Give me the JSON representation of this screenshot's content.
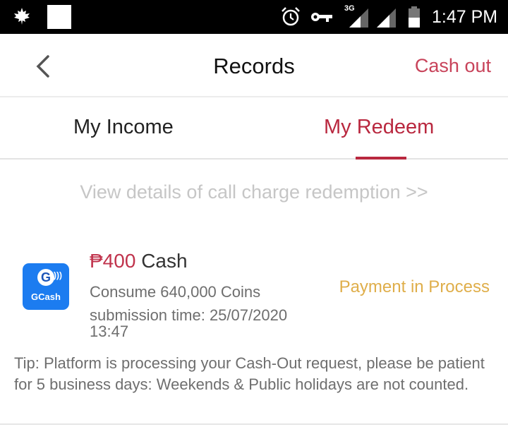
{
  "status_bar": {
    "time": "1:47 PM",
    "network": "3G",
    "icons": [
      "maple-leaf-icon",
      "notification-box-icon",
      "alarm-icon",
      "vpn-key-icon",
      "signal-3g-icon",
      "signal-icon",
      "battery-icon"
    ]
  },
  "header": {
    "title": "Records",
    "action_label": "Cash out",
    "back_icon": "chevron-left-icon"
  },
  "tabs": [
    {
      "label": "My Income",
      "active": false
    },
    {
      "label": "My Redeem",
      "active": true
    }
  ],
  "view_details_link": "View details of call charge redemption >>",
  "records": [
    {
      "provider": "GCash",
      "provider_icon": "gcash-logo-icon",
      "amount": "₱400",
      "amount_unit": "Cash",
      "consume": "Consume 640,000 Coins",
      "submission_time": "submission time: 25/07/2020 13:47",
      "status": "Payment in Process",
      "tip": "Tip: Platform is processing your Cash-Out request, please be patient for 5 business days: Weekends & Public holidays are not counted."
    }
  ],
  "colors": {
    "accent": "#b9283f",
    "status_pending": "#dfae4a",
    "gcash_blue": "#1c7cf0"
  }
}
